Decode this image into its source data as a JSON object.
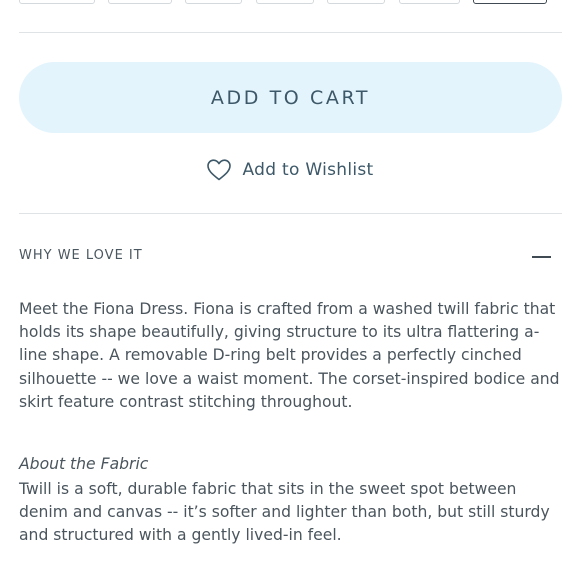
{
  "sizes": {
    "selected_index": 6
  },
  "cart": {
    "button_label": "ADD TO CART"
  },
  "wishlist": {
    "label": "Add to Wishlist",
    "icon": "heart-outline-icon"
  },
  "accordion": {
    "title": "WHY WE LOVE IT",
    "state": "expanded",
    "description": "Meet the Fiona Dress. Fiona is crafted from a washed twill fabric that holds its shape beautifully, giving structure to its ultra flattering a-line shape. A removable D-ring belt provides a perfectly cinched silhouette -- we love a waist moment. The corset-inspired bodice and skirt feature contrast stitching throughout.",
    "fabric_heading": "About the Fabric",
    "fabric_text": "Twill is a soft, durable fabric that sits in the sweet spot between denim and canvas -- it’s softer and lighter than both, but still sturdy and structured with a gently lived-in feel."
  },
  "colors": {
    "cart_button_bg": "#e3f4fc",
    "text": "#4a555d",
    "divider": "#dfe3e6"
  }
}
